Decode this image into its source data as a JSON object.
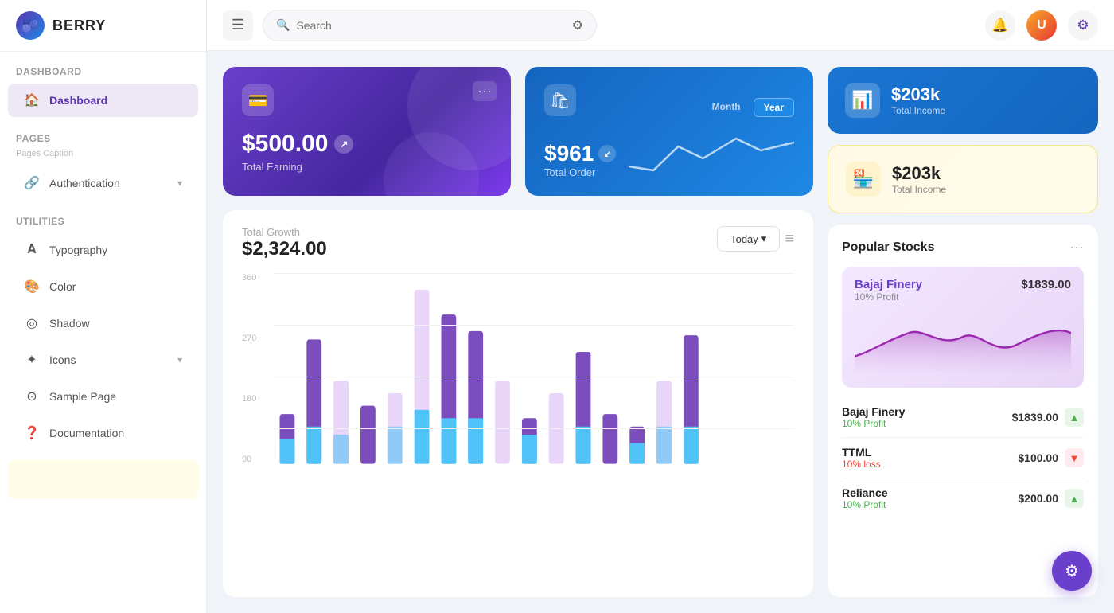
{
  "app": {
    "name": "BERRY",
    "logo_emoji": "🫐"
  },
  "topbar": {
    "menu_label": "☰",
    "search_placeholder": "Search",
    "notif_icon": "🔔",
    "settings_icon": "⚙",
    "avatar_letter": "U"
  },
  "sidebar": {
    "section_dashboard": "Dashboard",
    "nav_dashboard": "Dashboard",
    "section_pages": "Pages",
    "pages_caption": "Pages Caption",
    "nav_authentication": "Authentication",
    "section_utilities": "Utilities",
    "nav_typography": "Typography",
    "nav_color": "Color",
    "nav_shadow": "Shadow",
    "nav_icons": "Icons",
    "nav_sample_page": "Sample Page",
    "nav_documentation": "Documentation"
  },
  "cards": {
    "earning_amount": "$500.00",
    "earning_label": "Total Earning",
    "order_amount": "$961",
    "order_label": "Total Order",
    "tab_month": "Month",
    "tab_year": "Year",
    "income_blue_amount": "$203k",
    "income_blue_label": "Total Income",
    "income_yellow_amount": "$203k",
    "income_yellow_label": "Total Income"
  },
  "growth": {
    "label": "Total Growth",
    "amount": "$2,324.00",
    "btn_today": "Today",
    "y_labels": [
      "360",
      "270",
      "180",
      "90"
    ]
  },
  "stocks": {
    "title": "Popular Stocks",
    "featured_name": "Bajaj Finery",
    "featured_price": "$1839.00",
    "featured_change": "10% Profit",
    "rows": [
      {
        "name": "Bajaj Finery",
        "change": "10% Profit",
        "trend": "up",
        "price": "$1839.00"
      },
      {
        "name": "TTML",
        "change": "10% loss",
        "trend": "down",
        "price": "$100.00"
      },
      {
        "name": "Reliance",
        "change": "10% Profit",
        "trend": "up",
        "price": "$200.00"
      }
    ]
  },
  "floating_btn": "⚙"
}
